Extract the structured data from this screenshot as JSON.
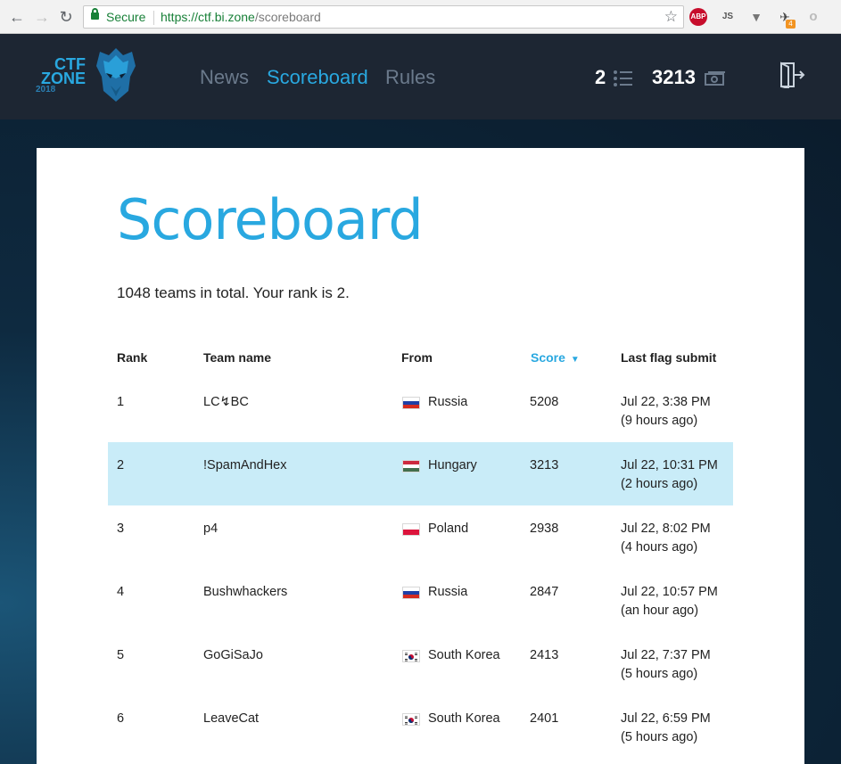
{
  "browser": {
    "secure_label": "Secure",
    "url_host": "https://ctf.bi.zone",
    "url_path": "/scoreboard",
    "extensions": {
      "abp": "ABP",
      "js": "JS",
      "ninja_badge": "4"
    }
  },
  "header": {
    "logo": {
      "line1": "CTF",
      "line2": "ZONE",
      "line3": "2018"
    },
    "nav": [
      {
        "label": "News",
        "active": false
      },
      {
        "label": "Scoreboard",
        "active": true
      },
      {
        "label": "Rules",
        "active": false
      }
    ],
    "rank_value": "2",
    "score_value": "3213",
    "colors": {
      "accent": "#29a8e0",
      "header_bg": "#1d2633",
      "muted": "#6b7a8c"
    }
  },
  "page": {
    "title": "Scoreboard",
    "summary": "1048 teams in total. Your rank is 2."
  },
  "table": {
    "headers": {
      "rank": "Rank",
      "team": "Team name",
      "from": "From",
      "score": "Score",
      "last": "Last flag submit"
    },
    "sort_icon": "▼",
    "rows": [
      {
        "rank": "1",
        "team": "LC↯BC",
        "flag": "ru",
        "country": "Russia",
        "score": "5208",
        "time": "Jul 22, 3:38 PM",
        "ago": "(9 hours ago)",
        "highlight": false
      },
      {
        "rank": "2",
        "team": "!SpamAndHex",
        "flag": "hu",
        "country": "Hungary",
        "score": "3213",
        "time": "Jul 22, 10:31 PM",
        "ago": "(2 hours ago)",
        "highlight": true
      },
      {
        "rank": "3",
        "team": "p4",
        "flag": "pl",
        "country": "Poland",
        "score": "2938",
        "time": "Jul 22, 8:02 PM",
        "ago": "(4 hours ago)",
        "highlight": false
      },
      {
        "rank": "4",
        "team": "Bushwhackers",
        "flag": "ru",
        "country": "Russia",
        "score": "2847",
        "time": "Jul 22, 10:57 PM",
        "ago": "(an hour ago)",
        "highlight": false
      },
      {
        "rank": "5",
        "team": "GoGiSaJo",
        "flag": "kr",
        "country": "South Korea",
        "score": "2413",
        "time": "Jul 22, 7:37 PM",
        "ago": "(5 hours ago)",
        "highlight": false
      },
      {
        "rank": "6",
        "team": "LeaveCat",
        "flag": "kr",
        "country": "South Korea",
        "score": "2401",
        "time": "Jul 22, 6:59 PM",
        "ago": "(5 hours ago)",
        "highlight": false
      }
    ]
  }
}
